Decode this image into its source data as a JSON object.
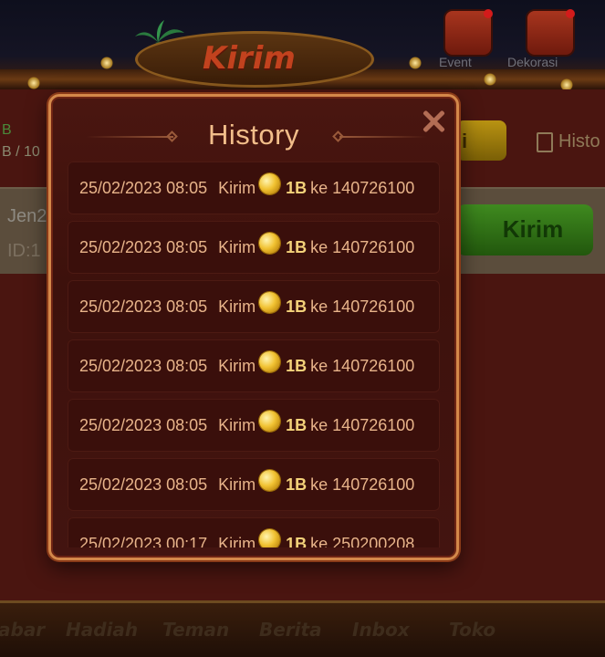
{
  "background": {
    "screen_title": "Kirim",
    "top_buttons": [
      {
        "label": "Event",
        "icon": "calendar-icon"
      },
      {
        "label": "Dekorasi",
        "icon": "gift-icon"
      }
    ],
    "left_stat_1": "B",
    "left_stat_2": "B / 10",
    "yellow_button_label": "i",
    "history_link_label": "Histo",
    "user_name": "Jen2",
    "user_id": "ID:1",
    "kirim_button_label": "Kirim",
    "nav": [
      "abar",
      "Hadiah",
      "Teman",
      "Berita",
      "Inbox",
      "Toko"
    ]
  },
  "modal": {
    "title": "History",
    "close_icon": "close-icon",
    "entries": [
      {
        "datetime": "25/02/2023 08:05",
        "action": "Kirim",
        "amount": "1B",
        "prep": "ke",
        "target_id": "140726100"
      },
      {
        "datetime": "25/02/2023 08:05",
        "action": "Kirim",
        "amount": "1B",
        "prep": "ke",
        "target_id": "140726100"
      },
      {
        "datetime": "25/02/2023 08:05",
        "action": "Kirim",
        "amount": "1B",
        "prep": "ke",
        "target_id": "140726100"
      },
      {
        "datetime": "25/02/2023 08:05",
        "action": "Kirim",
        "amount": "1B",
        "prep": "ke",
        "target_id": "140726100"
      },
      {
        "datetime": "25/02/2023 08:05",
        "action": "Kirim",
        "amount": "1B",
        "prep": "ke",
        "target_id": "140726100"
      },
      {
        "datetime": "25/02/2023 08:05",
        "action": "Kirim",
        "amount": "1B",
        "prep": "ke",
        "target_id": "140726100"
      },
      {
        "datetime": "25/02/2023 00:17",
        "action": "Kirim",
        "amount": "1B",
        "prep": "ke",
        "target_id": "250200208"
      }
    ]
  },
  "colors": {
    "accent_text": "#f2be8a",
    "row_text": "#e8b48a",
    "amount_text": "#f4d27a",
    "modal_border": "#d4884a",
    "coin": "#f1c232"
  }
}
